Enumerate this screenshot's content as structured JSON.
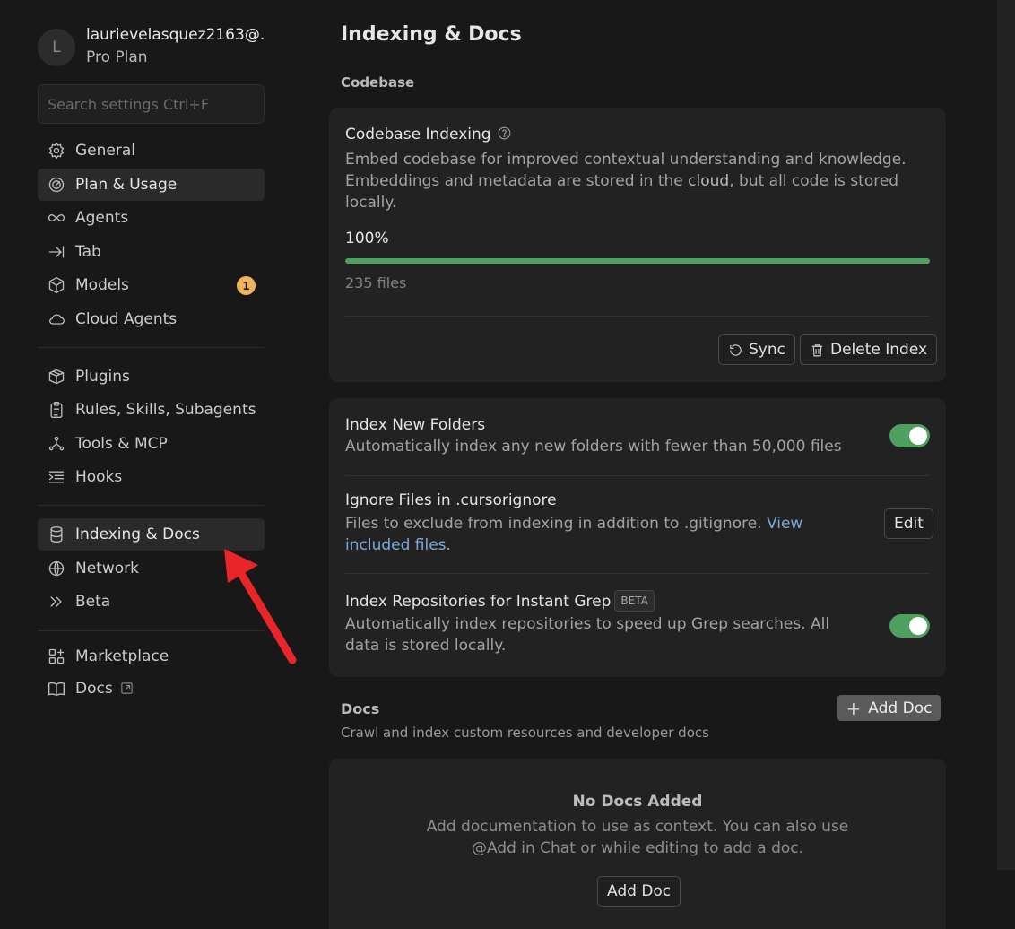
{
  "account": {
    "avatar_letter": "L",
    "email": "laurievelasquez2163@...",
    "plan": "Pro Plan"
  },
  "search": {
    "placeholder": "Search settings Ctrl+F"
  },
  "sidebar": {
    "group1": [
      {
        "label": "General",
        "icon": "gear-icon"
      },
      {
        "label": "Plan & Usage",
        "icon": "gauge-icon",
        "active": true
      },
      {
        "label": "Agents",
        "icon": "infinity-icon"
      },
      {
        "label": "Tab",
        "icon": "arrow-right-bar-icon"
      },
      {
        "label": "Models",
        "icon": "cube-icon",
        "badge": "1"
      },
      {
        "label": "Cloud Agents",
        "icon": "cloud-icon"
      }
    ],
    "group2": [
      {
        "label": "Plugins",
        "icon": "package-icon"
      },
      {
        "label": "Rules, Skills, Subagents",
        "icon": "clipboard-icon"
      },
      {
        "label": "Tools & MCP",
        "icon": "nodes-icon"
      },
      {
        "label": "Hooks",
        "icon": "list-indent-icon"
      }
    ],
    "group3": [
      {
        "label": "Indexing & Docs",
        "icon": "database-icon",
        "active": true
      },
      {
        "label": "Network",
        "icon": "globe-icon"
      },
      {
        "label": "Beta",
        "icon": "chevrons-right-icon"
      }
    ],
    "group4": [
      {
        "label": "Marketplace",
        "icon": "grid-plus-icon"
      },
      {
        "label": "Docs",
        "icon": "book-icon",
        "external": true
      }
    ]
  },
  "main": {
    "title": "Indexing & Docs",
    "codebase_section": "Codebase",
    "codebase_card": {
      "title": "Codebase Indexing",
      "desc_part1": "Embed codebase for improved contextual understanding and knowledge. Embeddings and metadata are stored in the ",
      "desc_link": "cloud",
      "desc_part2": ", but all code is stored locally.",
      "progress_label": "100%",
      "progress_value": 1.0,
      "files": "235 files",
      "sync_label": "Sync",
      "delete_label": "Delete Index"
    },
    "settings_card": {
      "index_new_folders": {
        "title": "Index New Folders",
        "desc": "Automatically index any new folders with fewer than 50,000 files",
        "enabled": true
      },
      "ignore_files": {
        "title": "Ignore Files in .cursorignore",
        "desc": "Files to exclude from indexing in addition to .gitignore. ",
        "link": "View included files",
        "desc_end": ".",
        "edit_label": "Edit"
      },
      "instant_grep": {
        "title": "Index Repositories for Instant Grep",
        "badge": "BETA",
        "desc": "Automatically index repositories to speed up Grep searches. All data is stored locally.",
        "enabled": true
      }
    },
    "docs_section": {
      "title": "Docs",
      "subtitle": "Crawl and index custom resources and developer docs",
      "add_doc_label": "Add Doc"
    },
    "docs_empty": {
      "title": "No Docs Added",
      "desc": "Add documentation to use as context. You can also use @Add in Chat or while editing to add a doc.",
      "button": "Add Doc"
    }
  },
  "colors": {
    "background": "#181818",
    "card": "#222222",
    "accent_green": "#4ea05e",
    "badge_orange": "#f0b35a",
    "link_blue": "#7ea7d8",
    "annotation_arrow": "#e8262a"
  }
}
